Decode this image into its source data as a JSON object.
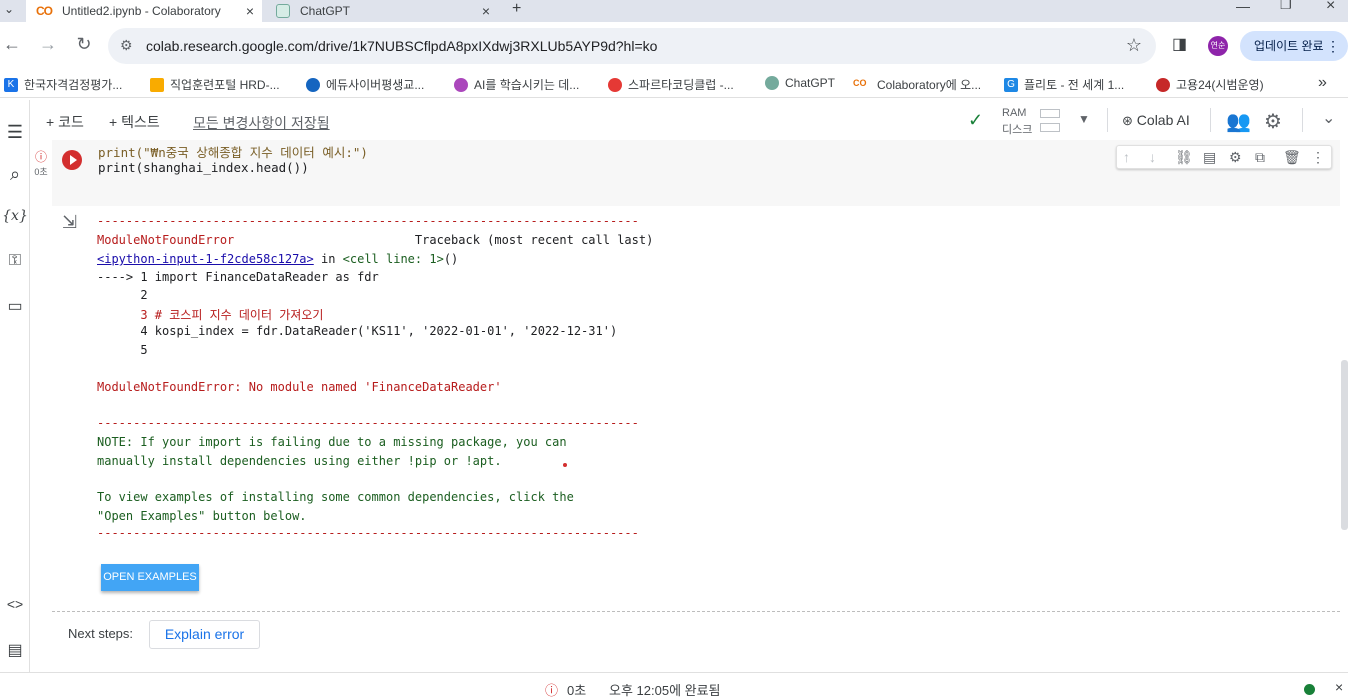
{
  "browser": {
    "tabs": [
      {
        "label": "Untitled2.ipynb - Colaboratory",
        "logo": "CO"
      },
      {
        "label": "ChatGPT"
      }
    ],
    "new_tab": "+",
    "close": "×",
    "url": "colab.research.google.com/drive/1k7NUBSCflpdA8pxIXdwj3RXLUb5AYP9d?hl=ko",
    "profile_initials": "연순",
    "update_label": "업데이트 완료",
    "more": "⋮"
  },
  "bookmarks": [
    {
      "label": "한국자격검정평가...",
      "color": "#1a73e8",
      "glyph": "K"
    },
    {
      "label": "직업훈련포털 HRD-...",
      "color": "#f9ab00",
      "glyph": ""
    },
    {
      "label": "에듀사이버평생교...",
      "color": "#1565c0",
      "glyph": ""
    },
    {
      "label": "AI를 학습시키는 데...",
      "color": "#ab47bc",
      "glyph": ""
    },
    {
      "label": "스파르타코딩클럽 -...",
      "color": "#e53935",
      "glyph": ""
    },
    {
      "label": "ChatGPT",
      "color": "#74aa9c",
      "glyph": ""
    },
    {
      "label": "Colaboratory에 오...",
      "color": "#e8710a",
      "glyph": "CO"
    },
    {
      "label": "플리토 - 전 세계 1...",
      "color": "#1e88e5",
      "glyph": "G"
    },
    {
      "label": "고용24(시범운영)",
      "color": "#c62828",
      "glyph": ""
    }
  ],
  "bookmarks_more": "»",
  "toolbar": {
    "add_code": "+ 코드",
    "add_text": "+ 텍스트",
    "saved_status": "모든 변경사항이 저장됨",
    "ram_label": "RAM",
    "disk_label": "디스크",
    "colab_ai": "Colab AI"
  },
  "cell": {
    "exec_time": "0초",
    "code_lines": [
      "print(\"₩n중국 상해종합 지수 데이터 예시:\")",
      "print(shanghai_index.head())"
    ]
  },
  "output": {
    "separator": "---------------------------------------------------------------------------",
    "error_name": "ModuleNotFoundError",
    "traceback_label": "Traceback (most recent call last)",
    "input_link": "<ipython-input-1-f2cde58c127a>",
    "in_text": " in ",
    "cell_line": "<cell line: 1>",
    "paren": "()",
    "tb_lines": [
      "----> 1 import FinanceDataReader as fdr",
      "      2",
      "      3 # 코스피 지수 데이터 가져오기",
      "      4 kospi_index = fdr.DataReader('KS11', '2022-01-01', '2022-12-31')",
      "      5"
    ],
    "error_message": "ModuleNotFoundError: No module named 'FinanceDataReader'",
    "note_lines": [
      "NOTE: If your import is failing due to a missing package, you can",
      "manually install dependencies using either !pip or !apt.",
      "",
      "To view examples of installing some common dependencies, click the",
      "\"Open Examples\" button below."
    ],
    "open_examples": "OPEN EXAMPLES"
  },
  "next_steps": {
    "label": "Next steps:",
    "explain_error": "Explain error"
  },
  "statusbar": {
    "time": "0초",
    "completed": "오후 12:05에 완료됨"
  }
}
